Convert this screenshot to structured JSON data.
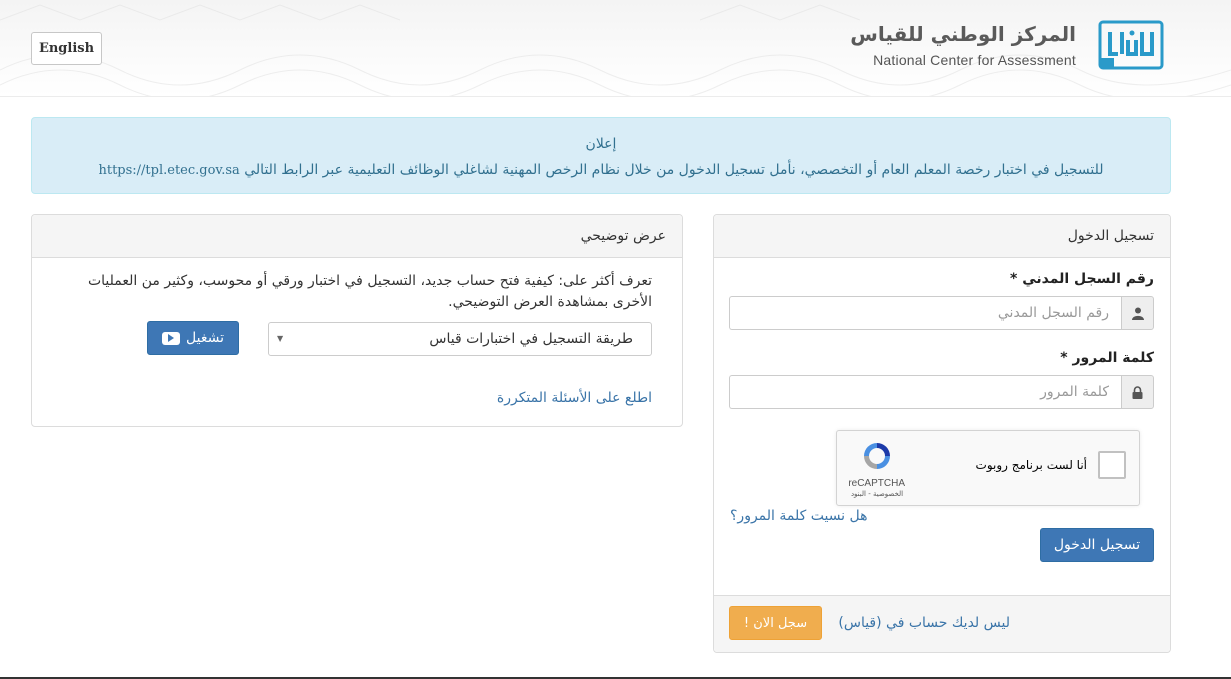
{
  "header": {
    "lang_button": "English",
    "brand_ar": "المركز الوطني للقياس",
    "brand_en": "National Center for Assessment",
    "logo_text": "QIYAS"
  },
  "notice": {
    "title": "إعلان",
    "text": "للتسجيل في اختبار رخصة المعلم العام أو التخصصي، نأمل تسجيل الدخول من خلال نظام الرخص المهنية لشاغلي الوظائف التعليمية عبر الرابط التالي",
    "link": "https://tpl.etec.gov.sa"
  },
  "login": {
    "heading": "تسجيل الدخول",
    "id_label": "رقم السجل المدني *",
    "id_placeholder": "رقم السجل المدني",
    "id_icon": "user-icon",
    "password_label": "كلمة المرور *",
    "password_placeholder": "كلمة المرور",
    "password_icon": "lock-icon",
    "captcha_label": "أنا لست برنامج روبوت",
    "captcha_brand": "reCAPTCHA",
    "captcha_links": "الخصوصية - البنود",
    "forgot": "هل نسيت كلمة المرور؟",
    "submit": "تسجيل الدخول",
    "no_account": "ليس لديك حساب في (قياس)",
    "register": "سجل الان !"
  },
  "demo": {
    "heading": "عرض توضيحي",
    "text": "تعرف أكثر على: كيفية فتح حساب جديد، التسجيل في اختبار ورقي أو محوسب، وكثير من العمليات الأخرى بمشاهدة العرض التوضيحي.",
    "select_value": "طريقة التسجيل في اختبارات قياس",
    "play": "تشغيل",
    "faq": "اطلع على الأسئلة المتكررة"
  },
  "colors": {
    "primary": "#3e77b5",
    "warning": "#f0ad4e",
    "info_bg": "#d9edf7",
    "link": "#3a74a8"
  }
}
